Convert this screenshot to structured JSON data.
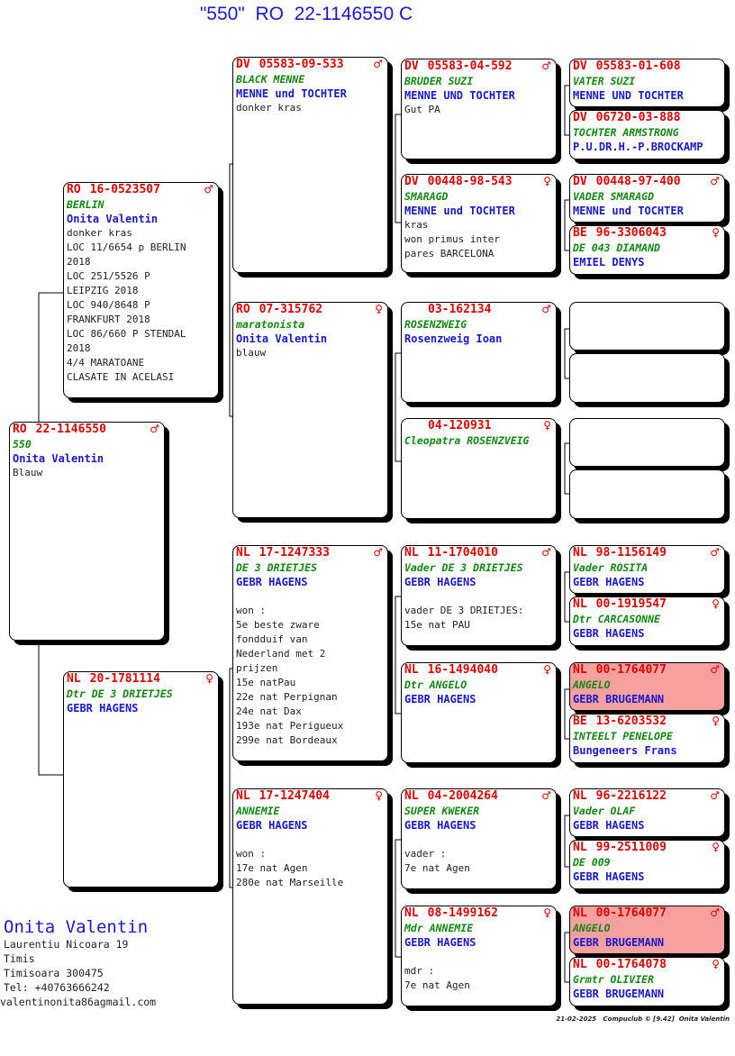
{
  "title": "\"550\"  RO  22-1146550 C",
  "cards": [
    {
      "id": "subject",
      "country": "RO",
      "ring": "22-1146550",
      "sex": "♂",
      "name": "550",
      "owner": "Onita Valentin",
      "info": "Blauw"
    },
    {
      "id": "father",
      "country": "RO",
      "ring": "16-0523507",
      "sex": "♂",
      "name": "BERLIN",
      "owner": "Onita Valentin",
      "info": "donker kras\nLOC 11/6654 p BERLIN\n2018\nLOC 251/5526 P\nLEIPZIG 2018\nLOC 940/8648 P\nFRANKFURT 2018\nLOC 86/660 P STENDAL\n2018\n4/4 MARATOANE\nCLASATE IN ACELASI"
    },
    {
      "id": "mother",
      "country": "NL",
      "ring": "20-1781114",
      "sex": "♀",
      "name": "Dtr DE 3 DRIETJES",
      "owner": "GEBR HAGENS",
      "info": ""
    },
    {
      "id": "ff",
      "country": "DV",
      "ring": "05583-09-533",
      "sex": "♂",
      "name": "BLACK MENNE",
      "owner": "MENNE und TOCHTER",
      "info": "donker kras"
    },
    {
      "id": "fm",
      "country": "RO",
      "ring": "07-315762",
      "sex": "♀",
      "name": "maratonista",
      "owner": "Onita Valentin",
      "info": "blauw"
    },
    {
      "id": "mf",
      "country": "NL",
      "ring": "17-1247333",
      "sex": "♂",
      "name": "DE 3 DRIETJES",
      "owner": "GEBR HAGENS",
      "info": "\nwon :\n5e beste zware\nfondduif van\nNederland met 2\nprijzen\n15e natPau\n22e nat Perpignan\n24e nat Dax\n193e nat Perigueux\n299e nat Bordeaux"
    },
    {
      "id": "mm",
      "country": "NL",
      "ring": "17-1247404",
      "sex": "♀",
      "name": "ANNEMIE",
      "owner": "GEBR HAGENS",
      "info": "\nwon :\n17e nat Agen\n280e nat Marseille"
    },
    {
      "id": "fff",
      "country": "DV",
      "ring": "05583-04-592",
      "sex": "♂",
      "name": "BRUDER SUZI",
      "owner": "MENNE UND TOCHTER",
      "info": "Gut PA"
    },
    {
      "id": "ffm",
      "country": "DV",
      "ring": "00448-98-543",
      "sex": "♀",
      "name": "SMARAGD",
      "owner": "MENNE und TOCHTER",
      "info": "kras\nwon primus inter\npares BARCELONA"
    },
    {
      "id": "fmf",
      "country": "",
      "ring": "03-162134",
      "sex": "♂",
      "name": "ROSENZWEIG",
      "owner": "Rosenzweig Ioan",
      "info": ""
    },
    {
      "id": "fmm",
      "country": "",
      "ring": "04-120931",
      "sex": "♀",
      "name": "Cleopatra ROSENZVEIG",
      "owner": "",
      "info": ""
    },
    {
      "id": "mff",
      "country": "NL",
      "ring": "11-1704010",
      "sex": "♂",
      "name": "Vader DE 3 DRIETJES",
      "owner": "GEBR HAGENS",
      "info": "\nvader DE 3 DRIETJES:\n15e nat PAU"
    },
    {
      "id": "mfm",
      "country": "NL",
      "ring": "16-1494040",
      "sex": "♀",
      "name": "Dtr ANGELO",
      "owner": "GEBR HAGENS",
      "info": ""
    },
    {
      "id": "mmf",
      "country": "NL",
      "ring": "04-2004264",
      "sex": "♂",
      "name": "SUPER KWEKER",
      "owner": "GEBR HAGENS",
      "info": "\nvader :\n7e nat Agen"
    },
    {
      "id": "mmm",
      "country": "NL",
      "ring": "08-1499162",
      "sex": "♀",
      "name": "Mdr ANNEMIE",
      "owner": "GEBR HAGENS",
      "info": "\nmdr :\n7e nat Agen"
    },
    {
      "id": "g1",
      "country": "DV",
      "ring": "05583-01-608",
      "sex": "",
      "name": "VATER SUZI",
      "owner": "MENNE UND TOCHTER",
      "info": ""
    },
    {
      "id": "g2",
      "country": "DV",
      "ring": "06720-03-888",
      "sex": "",
      "name": "TOCHTER ARMSTRONG",
      "owner": "P.U.DR.H.-P.BROCKAMP",
      "info": ""
    },
    {
      "id": "g3",
      "country": "DV",
      "ring": "00448-97-400",
      "sex": "♂",
      "name": "VADER SMARAGD",
      "owner": "MENNE und TOCHTER",
      "info": ""
    },
    {
      "id": "g4",
      "country": "BE",
      "ring": "96-3306043",
      "sex": "♀",
      "name": "DE 043 DIAMAND",
      "owner": "EMIEL DENYS",
      "info": ""
    },
    {
      "id": "g5",
      "country": "",
      "ring": "",
      "sex": "",
      "name": "",
      "owner": "",
      "info": ""
    },
    {
      "id": "g6",
      "country": "",
      "ring": "",
      "sex": "",
      "name": "",
      "owner": "",
      "info": ""
    },
    {
      "id": "g7",
      "country": "",
      "ring": "",
      "sex": "",
      "name": "",
      "owner": "",
      "info": ""
    },
    {
      "id": "g8",
      "country": "",
      "ring": "",
      "sex": "",
      "name": "",
      "owner": "",
      "info": ""
    },
    {
      "id": "g9",
      "country": "NL",
      "ring": "98-1156149",
      "sex": "♂",
      "name": "Vader ROSITA",
      "owner": "GEBR HAGENS",
      "info": ""
    },
    {
      "id": "g10",
      "country": "NL",
      "ring": "00-1919547",
      "sex": "♀",
      "name": "Dtr CARCASONNE",
      "owner": "GEBR HAGENS",
      "info": ""
    },
    {
      "id": "g11",
      "country": "NL",
      "ring": "00-1764077",
      "sex": "♂",
      "name": "ANGELO",
      "owner": "GEBR BRUGEMANN",
      "info": "",
      "highlight": "#f7a0a0"
    },
    {
      "id": "g12",
      "country": "BE",
      "ring": "13-6203532",
      "sex": "♀",
      "name": "INTEELT PENELOPE",
      "owner": "Bungeneers Frans",
      "info": ""
    },
    {
      "id": "g13",
      "country": "NL",
      "ring": "96-2216122",
      "sex": "♂",
      "name": "Vader OLAF",
      "owner": "GEBR HAGENS",
      "info": ""
    },
    {
      "id": "g14",
      "country": "NL",
      "ring": "99-2511009",
      "sex": "♀",
      "name": "DE 009",
      "owner": "GEBR HAGENS",
      "info": ""
    },
    {
      "id": "g15",
      "country": "NL",
      "ring": "00-1764077",
      "sex": "♂",
      "name": "ANGELO",
      "owner": "GEBR BRUGEMANN",
      "info": "",
      "highlight": "#f7a0a0"
    },
    {
      "id": "g16",
      "country": "NL",
      "ring": "00-1764078",
      "sex": "♀",
      "name": "Grmtr OLIVIER",
      "owner": "GEBR BRUGEMANN",
      "info": ""
    }
  ],
  "breeder": {
    "name": "Onita Valentin",
    "street": "Laurentiu Nicoara 19",
    "county": "Timis",
    "city": "Timisoara 300475",
    "phone": "Tel: +40763666242",
    "email": "valentinonita86agmail.com"
  },
  "footer": "21-02-2025   Compuclub © [9.42]  Onita Valentin",
  "colors": {
    "ring": "#dd0000",
    "name": "#118811",
    "owner": "#1a1acc",
    "highlight": "#f7a0a0"
  }
}
